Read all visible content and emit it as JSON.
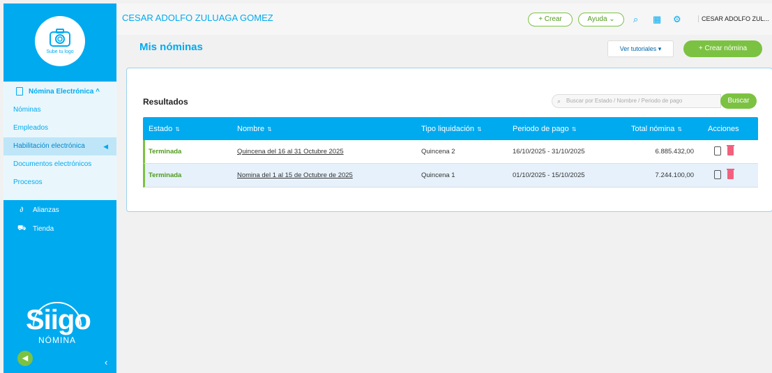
{
  "sidebar": {
    "logo_label": "Sube tu logo",
    "section_title": "Nómina Electrónica ^",
    "items": [
      {
        "label": "Nóminas"
      },
      {
        "label": "Empleados"
      },
      {
        "label": "Habilitación electrónica"
      },
      {
        "label": "Documentos electrónicos"
      },
      {
        "label": "Procesos"
      }
    ],
    "active_index": 2,
    "dark_items": [
      {
        "label": "Alianzas",
        "icon": "link-icon"
      },
      {
        "label": "Tienda",
        "icon": "cart-icon"
      }
    ],
    "brand_word": "Siigo",
    "brand_sub": "NÓMINA"
  },
  "topbar": {
    "company": "CESAR ADOLFO ZULUAGA GOMEZ",
    "crear_label": "+ Crear",
    "ayuda_label": "Ayuda ⌄",
    "user": "CESAR ADOLFO ZUL..."
  },
  "page": {
    "title": "Mis nóminas",
    "tutorials_label": "Ver tutoriales ▾",
    "new_payroll_label": "+ Crear nómina"
  },
  "results": {
    "title": "Resultados",
    "search_placeholder": "Buscar por Estado / Nombre / Periodo de pago",
    "search_button": "Buscar",
    "columns": [
      "Estado",
      "Nombre",
      "Tipo liquidación",
      "Periodo de pago",
      "Total nómina",
      "Acciones"
    ],
    "rows": [
      {
        "estado": "Terminada",
        "nombre": "Quincena del 16 al 31 Octubre 2025",
        "tipo": "Quincena 2",
        "periodo": "16/10/2025 - 31/10/2025",
        "total": "6.885.432,00"
      },
      {
        "estado": "Terminada",
        "nombre": "Nomina del 1 al 15 de Octubre de 2025",
        "tipo": "Quincena 1",
        "periodo": "01/10/2025 - 15/10/2025",
        "total": "7.244.100,00"
      }
    ]
  },
  "colors": {
    "brand_blue": "#00aaef",
    "accent_green": "#7cc242",
    "delete_pink": "#f2607e"
  }
}
